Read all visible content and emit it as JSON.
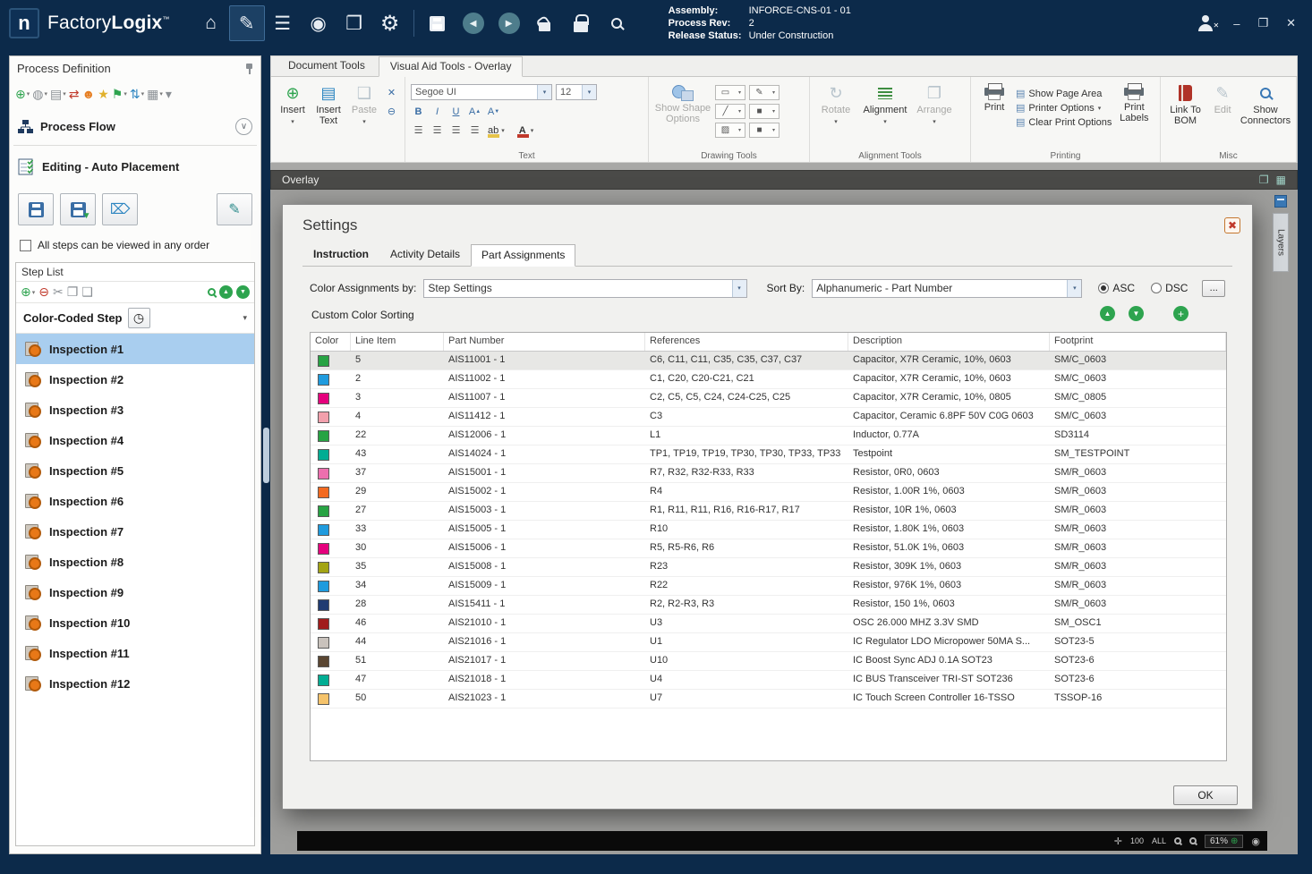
{
  "icons": {
    "logo_letter": "n",
    "home": "⌂",
    "edit_document": "✎",
    "stack": "☰",
    "compass": "◉",
    "copy": "❐",
    "gear": "⚙",
    "back": "◀",
    "forward": "▶",
    "minimize": "–",
    "maximize": "❐",
    "close": "✕",
    "add": "⊕",
    "remove": "⊖",
    "delete": "✕",
    "dropdown": "▾",
    "chevron_down": "∨",
    "scissors": "✂",
    "copy_doc": "❐",
    "paste_doc": "❑",
    "person": "☻",
    "star": "★",
    "flag": "⚑",
    "sync": "⇄",
    "updown": "⇅",
    "grid": "▦",
    "globe": "◍",
    "clock": "◷",
    "up": "▲",
    "down": "▼",
    "plus": "+",
    "close_dialog": "✖",
    "bold": "B",
    "italic": "I",
    "underline": "U",
    "letter_a": "A",
    "align": "☰",
    "swatch": "■",
    "rotate": "↻",
    "arrange": "❐",
    "pen": "✎",
    "shape_square": "▭",
    "shape_line": "╱",
    "shape_fill": "▨",
    "page": "▤",
    "move": "✛"
  },
  "titlebar": {
    "app_name_regular": "Factory",
    "app_name_bold": "Logix",
    "trademark": "™",
    "assembly_label": "Assembly:",
    "assembly_value": "INFORCE-CNS-01 - 01",
    "process_rev_label": "Process Rev:",
    "process_rev_value": "2",
    "release_status_label": "Release Status:",
    "release_status_value": "Under Construction"
  },
  "sidebar": {
    "title": "Process Definition",
    "process_flow": "Process Flow",
    "editing_mode": "Editing - Auto Placement",
    "order_checkbox_label": "All steps can be viewed in any order",
    "step_list": {
      "title": "Step List",
      "step_type": "Color-Coded Step",
      "selected_index": 0,
      "steps": [
        "Inspection #1",
        "Inspection #2",
        "Inspection #3",
        "Inspection #4",
        "Inspection #5",
        "Inspection #6",
        "Inspection #7",
        "Inspection #8",
        "Inspection #9",
        "Inspection #10",
        "Inspection #11",
        "Inspection #12"
      ]
    }
  },
  "ribbon": {
    "tabs": [
      "Document Tools",
      "Visual Aid Tools - Overlay"
    ],
    "insert": "Insert",
    "insert_text": "Insert Text",
    "paste": "Paste",
    "font_name": "Segoe UI",
    "font_size": "12",
    "ab_label": "ab",
    "font_color_label": "A",
    "show_shape_options": "Show Shape Options",
    "rotate": "Rotate",
    "alignment": "Alignment",
    "arrange": "Arrange",
    "print": "Print",
    "show_page_area": "Show Page Area",
    "printer_options": "Printer Options",
    "clear_print_options": "Clear Print Options",
    "print_labels": "Print Labels",
    "link_to_bom": "Link To BOM",
    "edit": "Edit",
    "show_connectors": "Show Connectors",
    "groups": {
      "text": "Text",
      "drawing": "Drawing Tools",
      "alignment": "Alignment Tools",
      "printing": "Printing",
      "misc": "Misc"
    }
  },
  "canvas": {
    "overlay_title": "Overlay",
    "layers_tab": "Layers",
    "status_100": "100",
    "status_all": "ALL",
    "zoom_value": "61%"
  },
  "settings": {
    "title": "Settings",
    "tabs": [
      "Instruction",
      "Activity Details",
      "Part Assignments"
    ],
    "color_assignments_label": "Color Assignments by:",
    "color_assignments_value": "Step Settings",
    "sort_by_label": "Sort By:",
    "sort_by_value": "Alphanumeric - Part Number",
    "asc": "ASC",
    "dsc": "DSC",
    "more_button": "...",
    "custom_color_sorting": "Custom Color Sorting",
    "ok": "OK",
    "table": {
      "columns": [
        "Color",
        "Line Item",
        "Part Number",
        "References",
        "Description",
        "Footprint"
      ],
      "selected_row": 0,
      "rows": [
        {
          "color": "#27A343",
          "line_item": "5",
          "part_number": "AIS11001 - 1",
          "references": "C6, C11, C11, C35, C35, C37, C37",
          "description": "Capacitor,  X7R Ceramic, 10%, 0603",
          "footprint": "SM/C_0603"
        },
        {
          "color": "#1F9BDE",
          "line_item": "2",
          "part_number": "AIS11002 - 1",
          "references": "C1, C20, C20-C21, C21",
          "description": "Capacitor,  X7R Ceramic, 10%, 0603",
          "footprint": "SM/C_0603"
        },
        {
          "color": "#E5007D",
          "line_item": "3",
          "part_number": "AIS11007 - 1",
          "references": "C2, C5, C5, C24, C24-C25, C25",
          "description": "Capacitor,  X7R Ceramic, 10%, 0805",
          "footprint": "SM/C_0805"
        },
        {
          "color": "#F2A0AC",
          "line_item": "4",
          "part_number": "AIS11412 - 1",
          "references": "C3",
          "description": "Capacitor, Ceramic 6.8PF 50V C0G 0603",
          "footprint": "SM/C_0603"
        },
        {
          "color": "#27A343",
          "line_item": "22",
          "part_number": "AIS12006 - 1",
          "references": "L1",
          "description": "Inductor, 0.77A",
          "footprint": "SD3114"
        },
        {
          "color": "#00AD93",
          "line_item": "43",
          "part_number": "AIS14024 - 1",
          "references": "TP1, TP19, TP19, TP30, TP30, TP33, TP33",
          "description": "Testpoint",
          "footprint": "SM_TESTPOINT"
        },
        {
          "color": "#ED6FAE",
          "line_item": "37",
          "part_number": "AIS15001 - 1",
          "references": "R7, R32, R32-R33, R33",
          "description": "Resistor, 0R0, 0603",
          "footprint": "SM/R_0603"
        },
        {
          "color": "#F26A21",
          "line_item": "29",
          "part_number": "AIS15002 - 1",
          "references": "R4",
          "description": "Resistor, 1.00R 1%, 0603",
          "footprint": "SM/R_0603"
        },
        {
          "color": "#27A343",
          "line_item": "27",
          "part_number": "AIS15003 - 1",
          "references": "R1, R11, R11, R16, R16-R17, R17",
          "description": "Resistor, 10R 1%, 0603",
          "footprint": "SM/R_0603"
        },
        {
          "color": "#1F9BDE",
          "line_item": "33",
          "part_number": "AIS15005 - 1",
          "references": "R10",
          "description": "Resistor, 1.80K 1%, 0603",
          "footprint": "SM/R_0603"
        },
        {
          "color": "#E5007D",
          "line_item": "30",
          "part_number": "AIS15006 - 1",
          "references": "R5, R5-R6, R6",
          "description": "Resistor, 51.0K 1%, 0603",
          "footprint": "SM/R_0603"
        },
        {
          "color": "#A3A414",
          "line_item": "35",
          "part_number": "AIS15008 - 1",
          "references": "R23",
          "description": "Resistor, 309K 1%, 0603",
          "footprint": "SM/R_0603"
        },
        {
          "color": "#1F9BDE",
          "line_item": "34",
          "part_number": "AIS15009 - 1",
          "references": "R22",
          "description": "Resistor, 976K 1%, 0603",
          "footprint": "SM/R_0603"
        },
        {
          "color": "#203B72",
          "line_item": "28",
          "part_number": "AIS15411 - 1",
          "references": "R2, R2-R3, R3",
          "description": "Resistor, 150 1%, 0603",
          "footprint": "SM/R_0603"
        },
        {
          "color": "#A11C1C",
          "line_item": "46",
          "part_number": "AIS21010 - 1",
          "references": "U3",
          "description": "OSC 26.000 MHZ 3.3V SMD",
          "footprint": "SM_OSC1"
        },
        {
          "color": "#C9C2BC",
          "line_item": "44",
          "part_number": "AIS21016 - 1",
          "references": "U1",
          "description": "IC Regulator LDO Micropower 50MA S...",
          "footprint": "SOT23-5"
        },
        {
          "color": "#5A4632",
          "line_item": "51",
          "part_number": "AIS21017 - 1",
          "references": "U10",
          "description": "IC Boost Sync ADJ 0.1A SOT23",
          "footprint": "SOT23-6"
        },
        {
          "color": "#00AD93",
          "line_item": "47",
          "part_number": "AIS21018 - 1",
          "references": "U4",
          "description": "IC BUS Transceiver TRI-ST SOT236",
          "footprint": "SOT23-6"
        },
        {
          "color": "#F5C36B",
          "line_item": "50",
          "part_number": "AIS21023 - 1",
          "references": "U7",
          "description": "IC Touch Screen Controller 16-TSSO",
          "footprint": "TSSOP-16"
        }
      ]
    }
  }
}
